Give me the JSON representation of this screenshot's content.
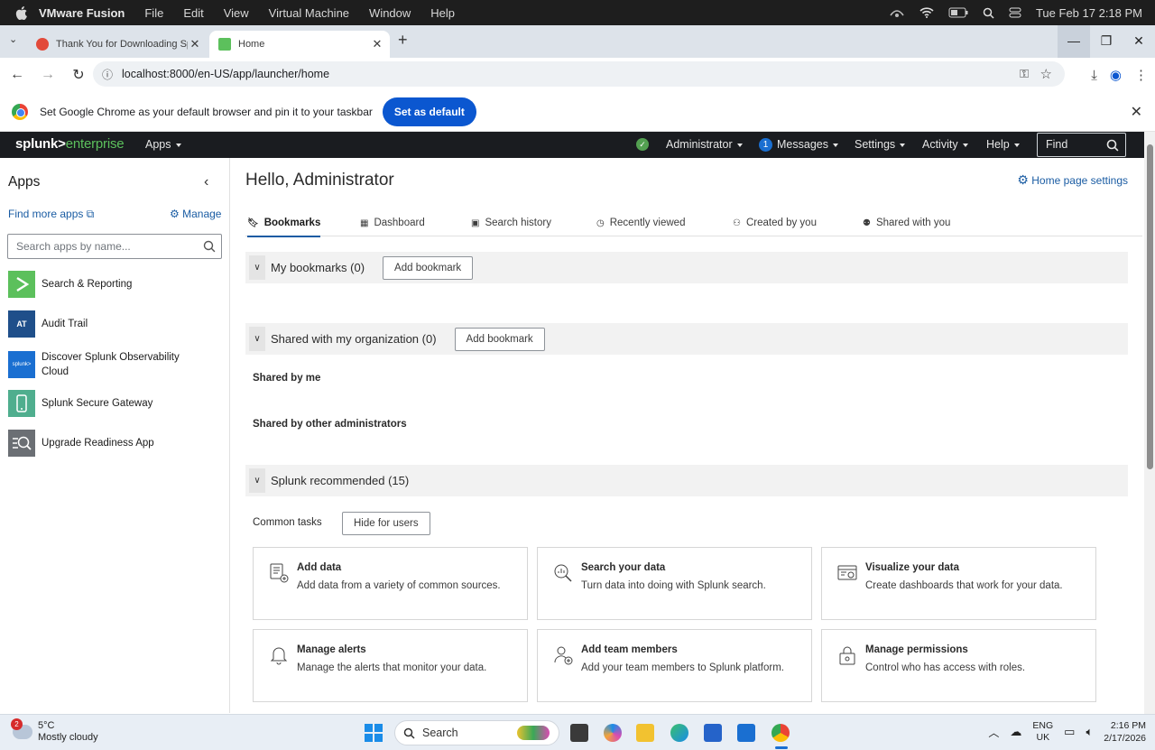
{
  "mac_menu": {
    "app": "VMware Fusion",
    "items": [
      "File",
      "Edit",
      "View",
      "Virtual Machine",
      "Window",
      "Help"
    ],
    "datetime": "Tue Feb 17  2:18 PM"
  },
  "browser": {
    "tabs": [
      {
        "title": "Thank You for Downloading Sp"
      },
      {
        "title": "Home"
      }
    ],
    "url": "localhost:8000/en-US/app/launcher/home",
    "infobar": {
      "message": "Set Google Chrome as your default browser and pin it to your taskbar",
      "button": "Set as default"
    }
  },
  "splunk_bar": {
    "logo_main": "splunk>",
    "logo_sub": "enterprise",
    "apps_menu": "Apps",
    "user_menu": "Administrator",
    "messages_count": "1",
    "messages_menu": "Messages",
    "settings_menu": "Settings",
    "activity_menu": "Activity",
    "help_menu": "Help",
    "find_placeholder": "Find"
  },
  "sidebar": {
    "title": "Apps",
    "find_more": "Find more apps",
    "manage": "Manage",
    "search_placeholder": "Search apps by name...",
    "apps": [
      {
        "name": "Search & Reporting",
        "icon_text": ""
      },
      {
        "name": "Audit Trail",
        "icon_text": "AT"
      },
      {
        "name": "Discover Splunk Observability Cloud",
        "icon_text": "splunk>"
      },
      {
        "name": "Splunk Secure Gateway",
        "icon_text": ""
      },
      {
        "name": "Upgrade Readiness App",
        "icon_text": ""
      }
    ]
  },
  "main": {
    "greeting": "Hello, Administrator",
    "home_settings": "Home page settings",
    "tabs": [
      "Bookmarks",
      "Dashboard",
      "Search history",
      "Recently viewed",
      "Created by you",
      "Shared with you"
    ],
    "sections": {
      "my_bookmarks": "My bookmarks (0)",
      "add_bookmark": "Add bookmark",
      "shared_org": "Shared with my organization (0)",
      "shared_by_me": "Shared by me",
      "shared_by_others": "Shared by other administrators",
      "recommended": "Splunk recommended (15)",
      "common_tasks": "Common tasks",
      "hide_for_users": "Hide for users"
    },
    "cards": [
      {
        "title": "Add data",
        "desc": "Add data from a variety of common sources."
      },
      {
        "title": "Search your data",
        "desc": "Turn data into doing with Splunk search."
      },
      {
        "title": "Visualize your data",
        "desc": "Create dashboards that work for your data."
      },
      {
        "title": "Manage alerts",
        "desc": "Manage the alerts that monitor your data."
      },
      {
        "title": "Add team members",
        "desc": "Add your team members to Splunk platform."
      },
      {
        "title": "Manage permissions",
        "desc": "Control who has access with roles."
      }
    ]
  },
  "taskbar": {
    "weather_badge": "2",
    "temp": "5°C",
    "condition": "Mostly cloudy",
    "search": "Search",
    "lang1": "ENG",
    "lang2": "UK",
    "time": "2:16 PM",
    "date": "2/17/2026"
  },
  "colors": {
    "accent_link": "#1a5ca3",
    "splunk_green": "#5cc05c",
    "status_ok": "#53a051"
  }
}
